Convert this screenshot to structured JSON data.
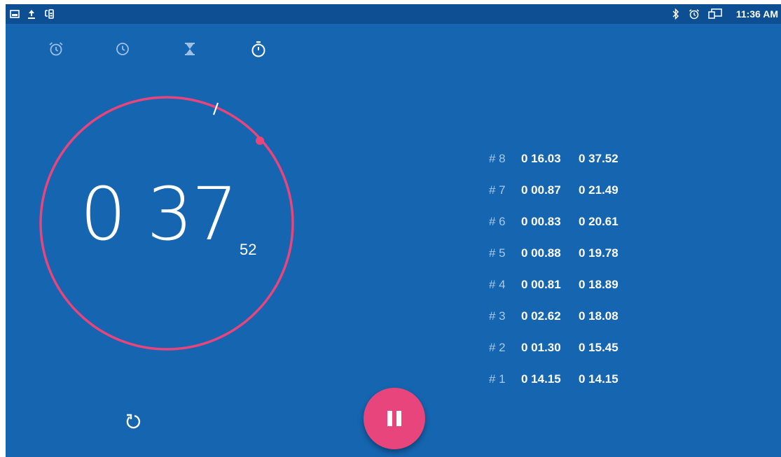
{
  "status_bar": {
    "left_icons": [
      "screenshot-icon",
      "upload-icon",
      "usb-debug-icon"
    ],
    "right_icons": [
      "bluetooth-icon",
      "alarm-status-icon",
      "screen-cast-icon"
    ],
    "time": "11:36 AM"
  },
  "tabs": [
    {
      "name": "alarm",
      "icon": "alarm-clock-icon",
      "active": false
    },
    {
      "name": "clock",
      "icon": "clock-icon",
      "active": false
    },
    {
      "name": "timer",
      "icon": "hourglass-icon",
      "active": false
    },
    {
      "name": "stopwatch",
      "icon": "stopwatch-icon",
      "active": true
    }
  ],
  "stopwatch": {
    "minutes": "0",
    "seconds": "37",
    "hundredths": "52",
    "ring_color": "#e8457d"
  },
  "laps": [
    {
      "num": "# 8",
      "lap": "0 16.03",
      "total": "0 37.52"
    },
    {
      "num": "# 7",
      "lap": "0 00.87",
      "total": "0 21.49"
    },
    {
      "num": "# 6",
      "lap": "0 00.83",
      "total": "0 20.61"
    },
    {
      "num": "# 5",
      "lap": "0 00.88",
      "total": "0 19.78"
    },
    {
      "num": "# 4",
      "lap": "0 00.81",
      "total": "0 18.89"
    },
    {
      "num": "# 3",
      "lap": "0 02.62",
      "total": "0 18.08"
    },
    {
      "num": "# 2",
      "lap": "0 01.30",
      "total": "0 15.45"
    },
    {
      "num": "# 1",
      "lap": "0 14.15",
      "total": "0 14.15"
    }
  ],
  "controls": {
    "reset_icon": "reset-icon",
    "pause_icon": "pause-icon"
  },
  "colors": {
    "background": "#1565b0",
    "status_bar": "#0d4f92",
    "accent": "#e8457d"
  }
}
